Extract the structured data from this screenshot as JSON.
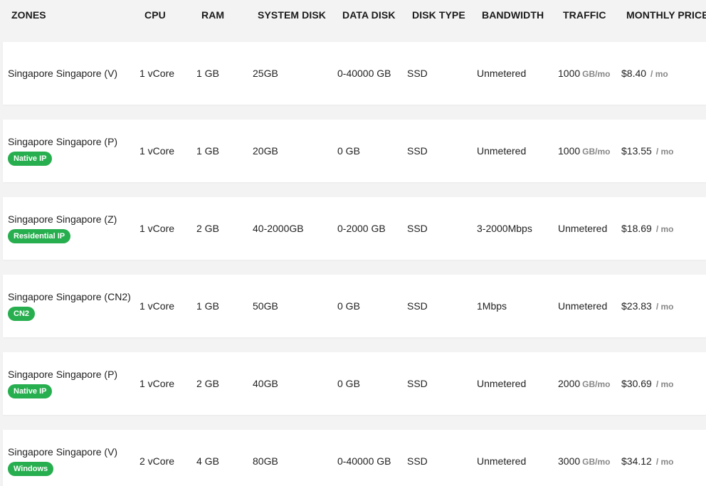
{
  "header": {
    "zones": "ZONES",
    "cpu": "CPU",
    "ram": "RAM",
    "system_disk": "SYSTEM DISK",
    "data_disk": "DATA DISK",
    "disk_type": "DISK TYPE",
    "bandwidth": "BANDWIDTH",
    "traffic": "TRAFFIC",
    "monthly_price": "MONTHLY PRICE"
  },
  "rows": [
    {
      "zone": "Singapore Singapore (V)",
      "badge": "",
      "cpu": "1 vCore",
      "ram": "1 GB",
      "system_disk": "25GB",
      "data_disk": "0-40000 GB",
      "disk_type": "SSD",
      "bandwidth": "Unmetered",
      "traffic": "1000",
      "traffic_unit": "GB/mo",
      "price": "$8.40",
      "price_unit": "/ mo"
    },
    {
      "zone": "Singapore Singapore (P)",
      "badge": "Native IP",
      "cpu": "1 vCore",
      "ram": "1 GB",
      "system_disk": "20GB",
      "data_disk": "0 GB",
      "disk_type": "SSD",
      "bandwidth": "Unmetered",
      "traffic": "1000",
      "traffic_unit": "GB/mo",
      "price": "$13.55",
      "price_unit": "/ mo"
    },
    {
      "zone": "Singapore Singapore (Z)",
      "badge": "Residential IP",
      "cpu": "1 vCore",
      "ram": "2 GB",
      "system_disk": "40-2000GB",
      "data_disk": "0-2000 GB",
      "disk_type": "SSD",
      "bandwidth": "3-2000Mbps",
      "traffic": "Unmetered",
      "traffic_unit": "",
      "price": "$18.69",
      "price_unit": "/ mo"
    },
    {
      "zone": "Singapore Singapore (CN2)",
      "badge": "CN2",
      "cpu": "1 vCore",
      "ram": "1 GB",
      "system_disk": "50GB",
      "data_disk": "0 GB",
      "disk_type": "SSD",
      "bandwidth": "1Mbps",
      "traffic": "Unmetered",
      "traffic_unit": "",
      "price": "$23.83",
      "price_unit": "/ mo"
    },
    {
      "zone": "Singapore Singapore (P)",
      "badge": "Native IP",
      "cpu": "1 vCore",
      "ram": "2 GB",
      "system_disk": "40GB",
      "data_disk": "0 GB",
      "disk_type": "SSD",
      "bandwidth": "Unmetered",
      "traffic": "2000",
      "traffic_unit": "GB/mo",
      "price": "$30.69",
      "price_unit": "/ mo"
    },
    {
      "zone": "Singapore Singapore (V)",
      "badge": "Windows",
      "cpu": "2 vCore",
      "ram": "4 GB",
      "system_disk": "80GB",
      "data_disk": "0-40000 GB",
      "disk_type": "SSD",
      "bandwidth": "Unmetered",
      "traffic": "3000",
      "traffic_unit": "GB/mo",
      "price": "$34.12",
      "price_unit": "/ mo"
    }
  ]
}
